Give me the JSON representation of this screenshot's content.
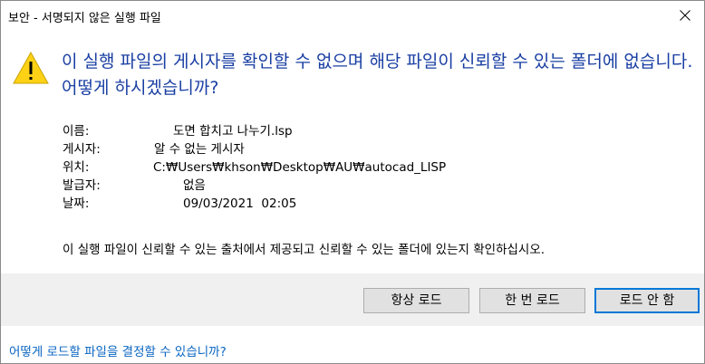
{
  "window": {
    "title": "보안 - 서명되지 않은 실행 파일",
    "close_glyph": "close-icon"
  },
  "warning": {
    "icon": "warning-triangle-icon",
    "heading": "이 실행 파일의 게시자를 확인할 수 없으며 해당 파일이 신뢰할 수 있는 폴더에 없습니다. 어떻게 하시겠습니까?"
  },
  "details": {
    "name_label": "이름:",
    "name_value": "도면 합치고 나누기.lsp",
    "publisher_label": "게시자:",
    "publisher_value": "알 수 없는 게시자",
    "location_label": "위치:",
    "location_value": "C:₩Users₩khson₩Desktop₩AU₩autocad_LISP",
    "issuer_label": "발급자:",
    "issuer_value": "없음",
    "date_label": "날짜:",
    "date_value": "09/03/2021  02:05"
  },
  "message": "이 실행 파일이 신뢰할 수 있는 출처에서 제공되고 신뢰할 수 있는 폴더에 있는지 확인하십시오.",
  "buttons": {
    "always_load": "항상 로드",
    "load_once": "한 번 로드",
    "do_not_load": "로드 안 함"
  },
  "help_link": "어떻게 로드할 파일을 결정할 수 있습니까?",
  "colors": {
    "heading": "#1a3fa3",
    "link": "#0a66c2",
    "warning_fill": "#fcd116",
    "button_bar": "#f0f0f0",
    "focus_border": "#0078d7"
  }
}
